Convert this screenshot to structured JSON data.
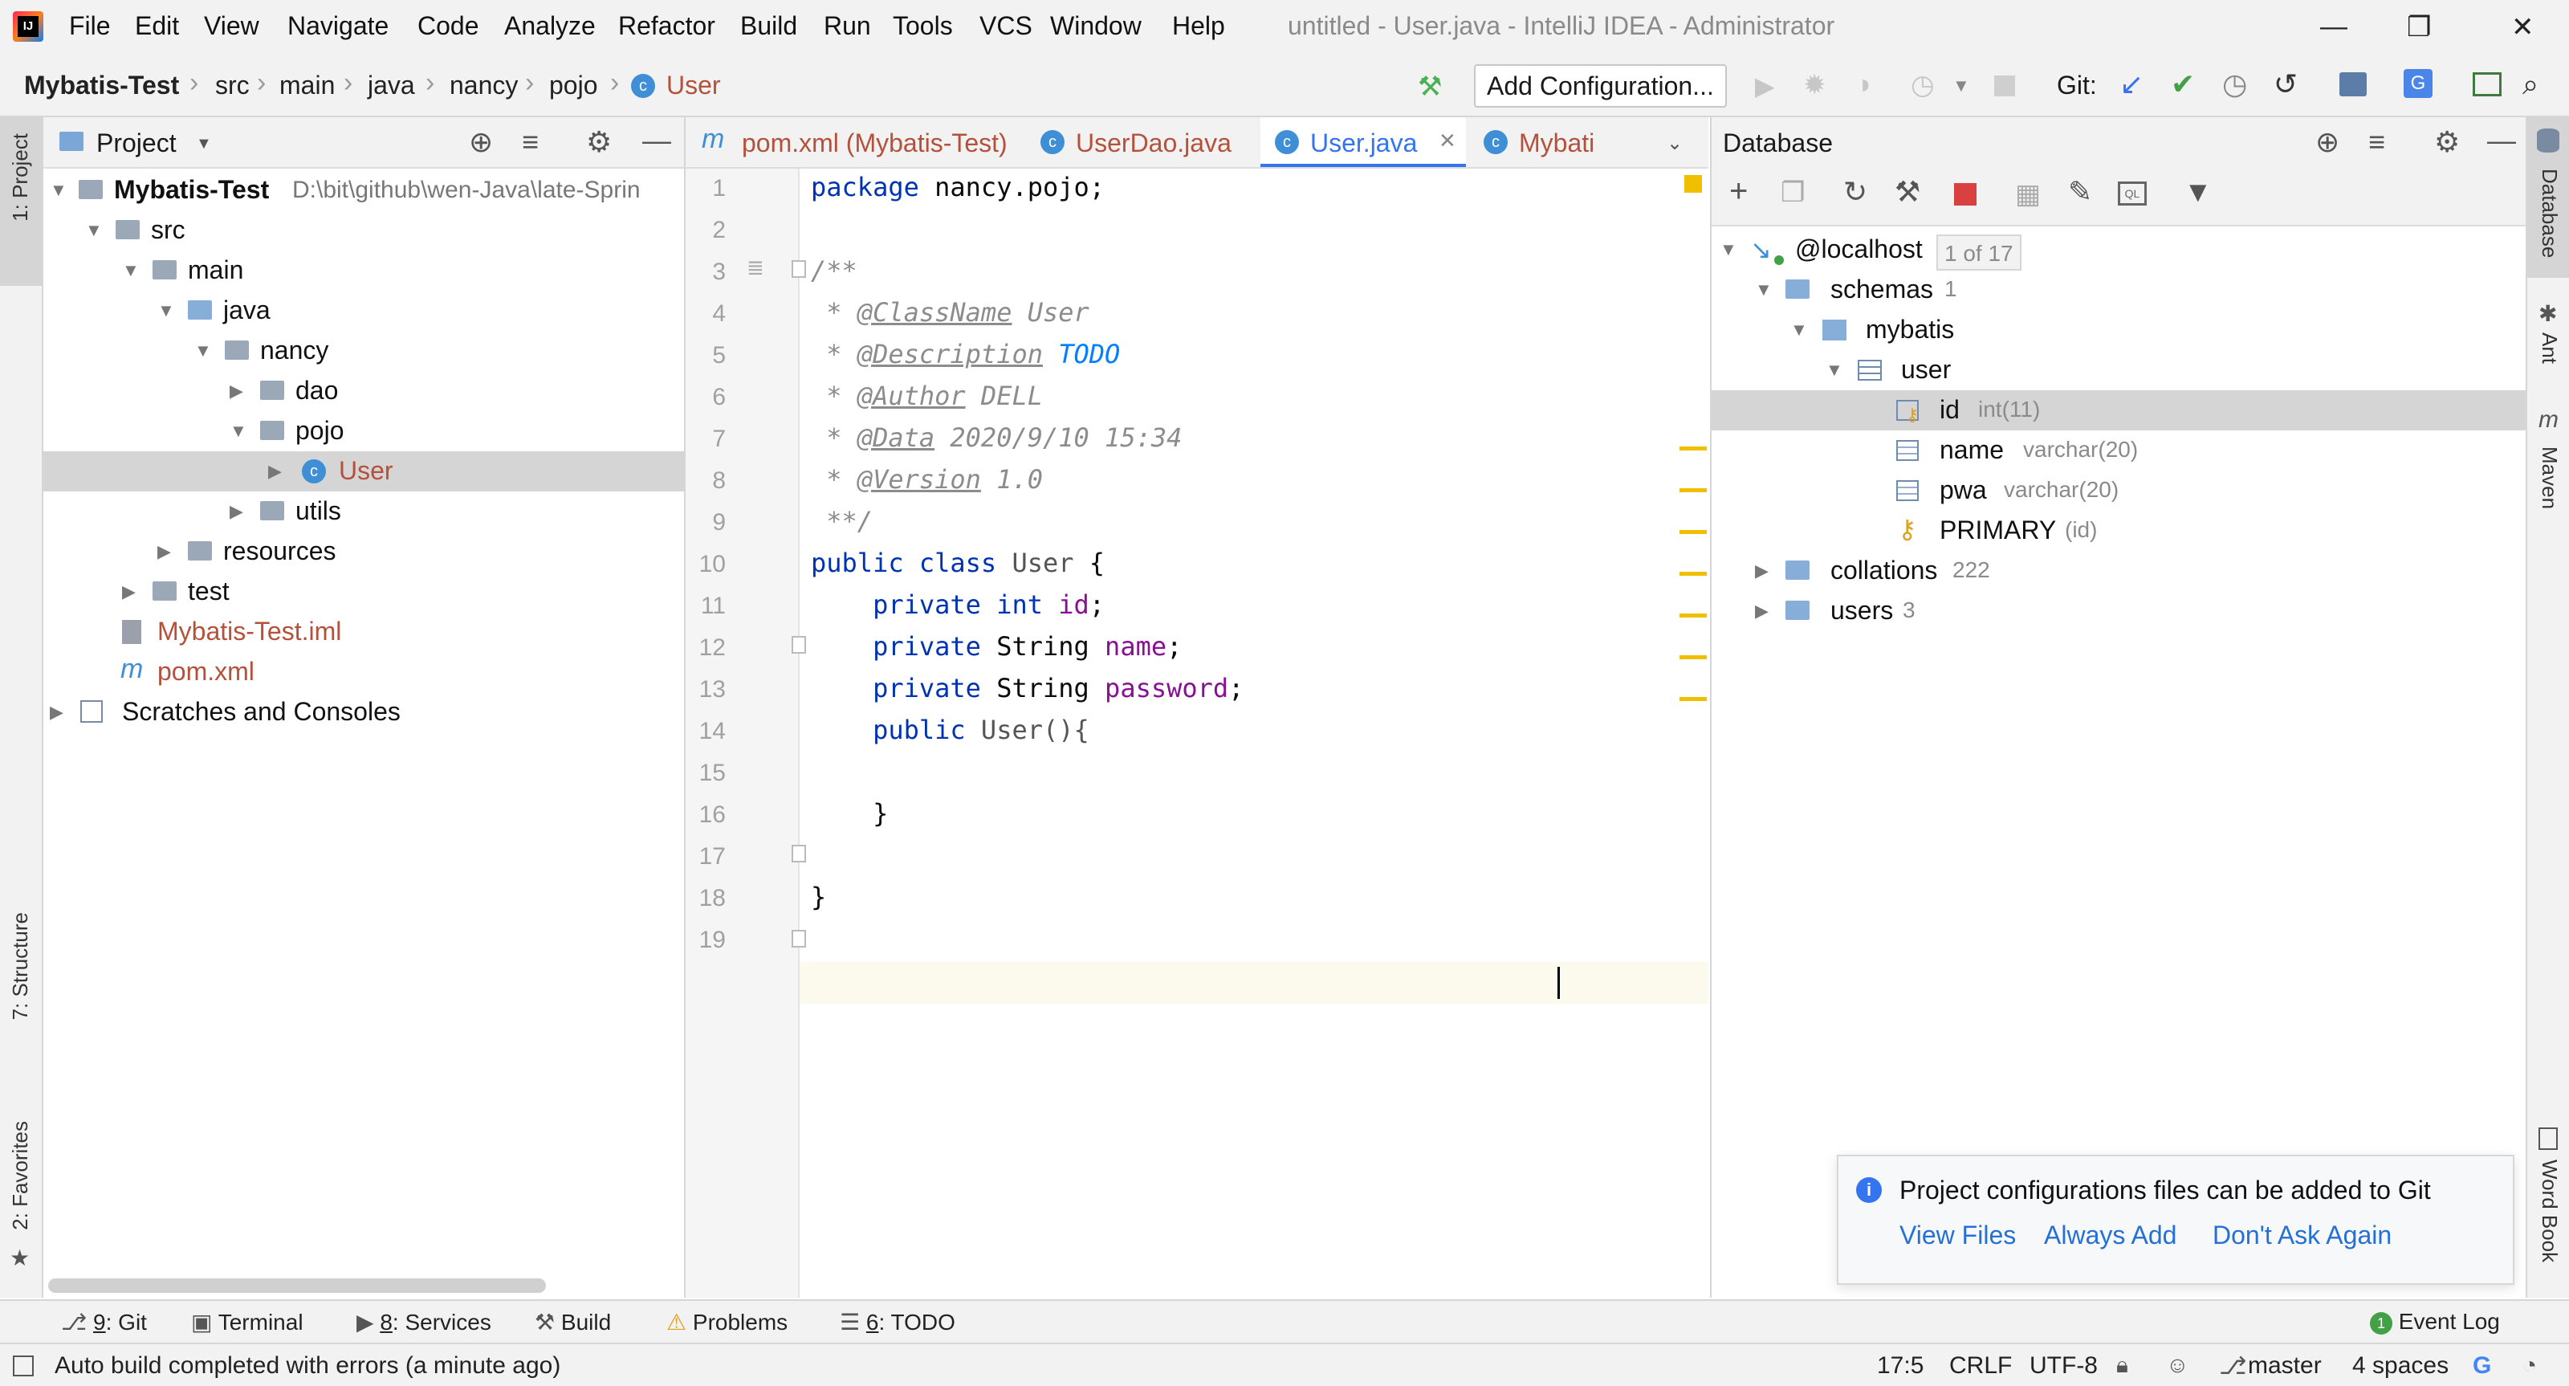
{
  "app": {
    "window_title": "untitled - User.java - IntelliJ IDEA - Administrator",
    "menu": [
      "File",
      "Edit",
      "View",
      "Navigate",
      "Code",
      "Analyze",
      "Refactor",
      "Build",
      "Run",
      "Tools",
      "VCS",
      "Window",
      "Help"
    ]
  },
  "navbar": {
    "breadcrumbs": [
      "Mybatis-Test",
      "src",
      "main",
      "java",
      "nancy",
      "pojo",
      "User"
    ],
    "run_config": "Add Configuration...",
    "git_label": "Git:"
  },
  "left_stripe": {
    "project": "1: Project",
    "structure": "7: Structure",
    "favorites": "2: Favorites"
  },
  "right_stripe": {
    "database": "Database",
    "ant": "Ant",
    "maven": "Maven",
    "word_book": "Word Book"
  },
  "project_panel": {
    "title": "Project",
    "tree": [
      {
        "label": "Mybatis-Test",
        "extra": "D:\\bit\\github\\wen-Java\\late-Sprin"
      },
      {
        "label": "src"
      },
      {
        "label": "main"
      },
      {
        "label": "java"
      },
      {
        "label": "nancy"
      },
      {
        "label": "dao"
      },
      {
        "label": "pojo"
      },
      {
        "label": "User"
      },
      {
        "label": "utils"
      },
      {
        "label": "resources"
      },
      {
        "label": "test"
      },
      {
        "label": "Mybatis-Test.iml"
      },
      {
        "label": "pom.xml"
      },
      {
        "label": "Scratches and Consoles"
      }
    ]
  },
  "editor": {
    "tabs": [
      "pom.xml (Mybatis-Test)",
      "UserDao.java",
      "User.java",
      "Mybati"
    ],
    "active_tab": "User.java",
    "line_numbers": [
      "1",
      "2",
      "3",
      "4",
      "5",
      "6",
      "7",
      "8",
      "9",
      "10",
      "11",
      "12",
      "13",
      "14",
      "15",
      "16",
      "17",
      "18",
      "19"
    ],
    "code": {
      "l1_kw": "package",
      "l1_rest": " nancy.pojo;",
      "l3": "/**",
      "l4_pre": " * ",
      "l4_tag": "@ClassName",
      "l4_val": " User",
      "l5_pre": " * ",
      "l5_tag": "@Description",
      "l5_val": " TODO",
      "l6_pre": " * ",
      "l6_tag": "@Author",
      "l6_val": " DELL",
      "l7_pre": " * ",
      "l7_tag": "@Data",
      "l7_val": " 2020/9/10 15:34",
      "l8_pre": " * ",
      "l8_tag": "@Version",
      "l8_val": " 1.0",
      "l9": " **/",
      "l10_kw": "public class",
      "l10_name": " User",
      "l10_rest": " {",
      "l11_kw": "    private int",
      "l11_fld": " id",
      "l11_end": ";",
      "l12_kw": "    private",
      "l12_type": " String",
      "l12_fld": " name",
      "l12_end": ";",
      "l13_kw": "    private",
      "l13_type": " String",
      "l13_fld": " password",
      "l13_end": ";",
      "l14_kw": "    public",
      "l14_rest": " User(){",
      "l16": "    }",
      "l18": "}"
    }
  },
  "database_panel": {
    "title": "Database",
    "host": "@localhost",
    "host_badge": "1 of 17",
    "schemas": "schemas",
    "schemas_count": "1",
    "db": "mybatis",
    "table": "user",
    "columns": [
      {
        "name": "id",
        "type": "int(11)"
      },
      {
        "name": "name",
        "type": "varchar(20)"
      },
      {
        "name": "pwa",
        "type": "varchar(20)"
      }
    ],
    "key": "PRIMARY",
    "key_cols": "(id)",
    "collations": "collations",
    "collations_count": "222",
    "users": "users",
    "users_count": "3"
  },
  "notification": {
    "message": "Project configurations files can be added to Git",
    "actions": [
      "View Files",
      "Always Add",
      "Don't Ask Again"
    ]
  },
  "bottom_tools": [
    {
      "key": "9",
      "label": ": Git"
    },
    {
      "key": "",
      "label": "Terminal"
    },
    {
      "key": "8",
      "label": ": Services"
    },
    {
      "key": "",
      "label": "Build"
    },
    {
      "key": "",
      "label": "Problems"
    },
    {
      "key": "6",
      "label": ": TODO"
    }
  ],
  "event_log": "Event Log",
  "status": {
    "message": "Auto build completed with errors (a minute ago)",
    "position": "17:5",
    "line_sep": "CRLF",
    "encoding": "UTF-8",
    "branch": "master",
    "indent": "4 spaces"
  },
  "colors": {
    "accent": "#3574f0",
    "folder": "#87aed8",
    "java_class": "#3f8fd6",
    "warning_marker": "#f0c000",
    "error_red": "#d94040"
  }
}
